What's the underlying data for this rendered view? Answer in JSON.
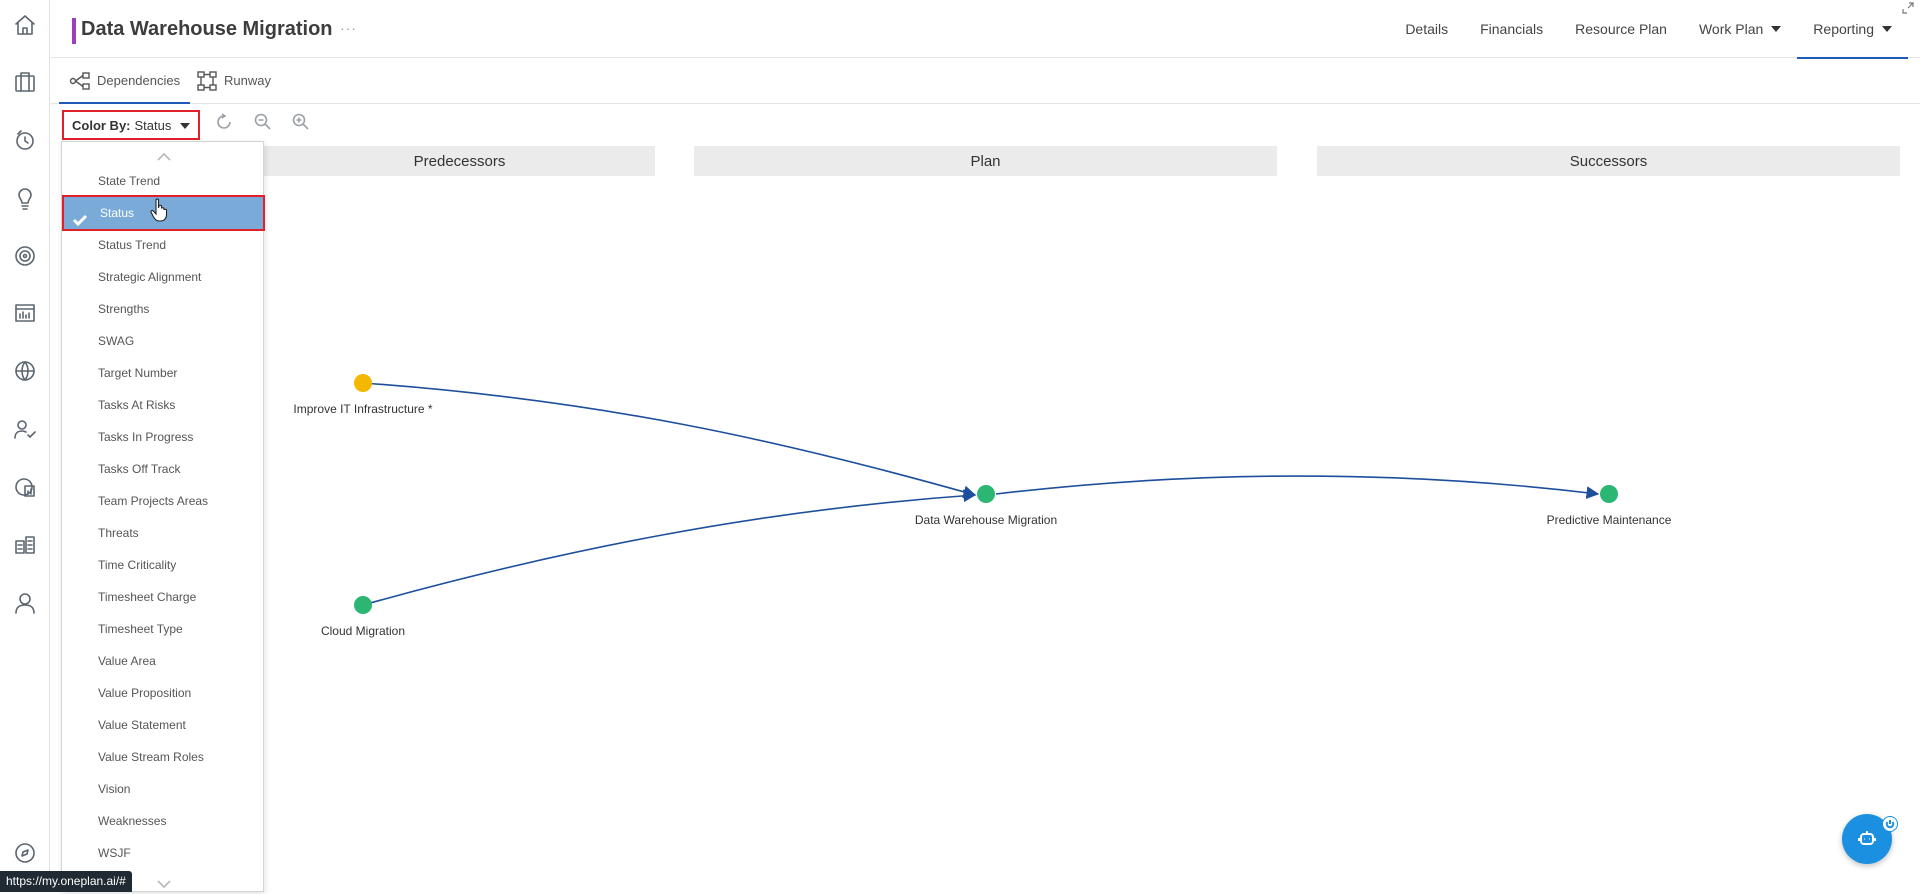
{
  "app": {
    "title": "Data Warehouse Migration",
    "title_more": "···",
    "accent_color": "#9b3fbf"
  },
  "topnav": [
    {
      "label": "Details",
      "caret": false,
      "active": false
    },
    {
      "label": "Financials",
      "caret": false,
      "active": false
    },
    {
      "label": "Resource Plan",
      "caret": false,
      "active": false
    },
    {
      "label": "Work Plan",
      "caret": true,
      "active": false
    },
    {
      "label": "Reporting",
      "caret": true,
      "active": true
    }
  ],
  "subtabs": [
    {
      "label": "Dependencies",
      "icon": "dependencies-icon",
      "active": true
    },
    {
      "label": "Runway",
      "icon": "runway-icon",
      "active": false
    }
  ],
  "toolbar": {
    "color_by_label": "Color By:",
    "color_by_value": "Status"
  },
  "dropdown": {
    "items": [
      "State Trend",
      "Status",
      "Status Trend",
      "Strategic Alignment",
      "Strengths",
      "SWAG",
      "Target Number",
      "Tasks At Risks",
      "Tasks In Progress",
      "Tasks Off Track",
      "Team Projects Areas",
      "Threats",
      "Time Criticality",
      "Timesheet Charge",
      "Timesheet Type",
      "Value Area",
      "Value Proposition",
      "Value Statement",
      "Value Stream Roles",
      "Vision",
      "Weaknesses",
      "WSJF"
    ],
    "selected": "Status"
  },
  "columns": {
    "predecessors": "Predecessors",
    "plan": "Plan",
    "successors": "Successors"
  },
  "nodes": {
    "improve_it": {
      "label": "Improve IT Infrastructure *",
      "color": "#f5b800"
    },
    "cloud": {
      "label": "Cloud Migration",
      "color": "#2bb673"
    },
    "dwm": {
      "label": "Data Warehouse Migration",
      "color": "#2bb673"
    },
    "predictive": {
      "label": "Predictive Maintenance",
      "color": "#2bb673"
    }
  },
  "edge_color": "#1e4f9c",
  "status_url": "https://my.oneplan.ai/#"
}
